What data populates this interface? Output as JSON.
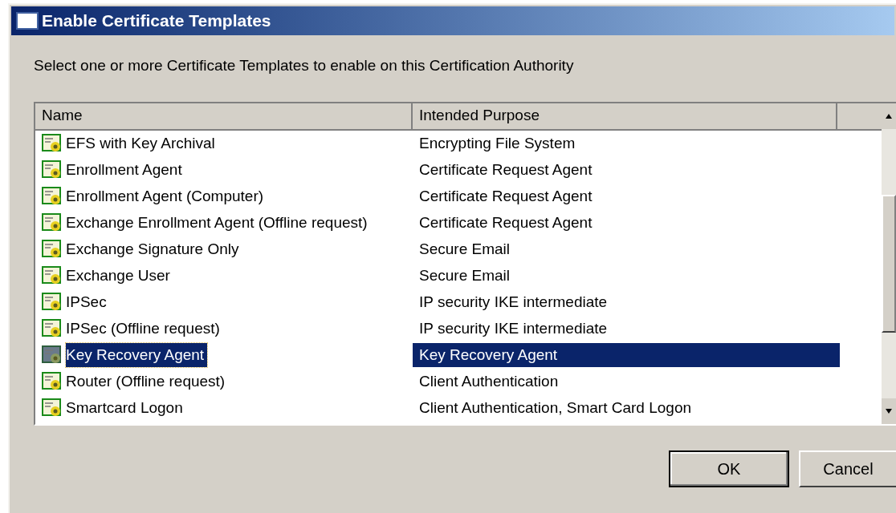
{
  "window": {
    "title": "Enable Certificate Templates"
  },
  "instruction": "Select one or more Certificate Templates to enable on this Certification Authority",
  "table": {
    "columns": [
      "Name",
      "Intended Purpose"
    ],
    "rows": [
      {
        "name": "EFS with Key Archival",
        "purpose": "Encrypting File System",
        "selected": false
      },
      {
        "name": "Enrollment Agent",
        "purpose": "Certificate Request Agent",
        "selected": false
      },
      {
        "name": "Enrollment Agent (Computer)",
        "purpose": "Certificate Request Agent",
        "selected": false
      },
      {
        "name": "Exchange Enrollment Agent (Offline request)",
        "purpose": "Certificate Request Agent",
        "selected": false
      },
      {
        "name": "Exchange Signature Only",
        "purpose": "Secure Email",
        "selected": false
      },
      {
        "name": "Exchange User",
        "purpose": "Secure Email",
        "selected": false
      },
      {
        "name": "IPSec",
        "purpose": "IP security IKE intermediate",
        "selected": false
      },
      {
        "name": "IPSec (Offline request)",
        "purpose": "IP security IKE intermediate",
        "selected": false
      },
      {
        "name": "Key Recovery Agent",
        "purpose": "Key Recovery Agent",
        "selected": true
      },
      {
        "name": "Router (Offline request)",
        "purpose": "Client Authentication",
        "selected": false
      },
      {
        "name": "Smartcard Logon",
        "purpose": "Client Authentication, Smart Card Logon",
        "selected": false
      }
    ]
  },
  "buttons": [
    "OK",
    "Cancel"
  ]
}
